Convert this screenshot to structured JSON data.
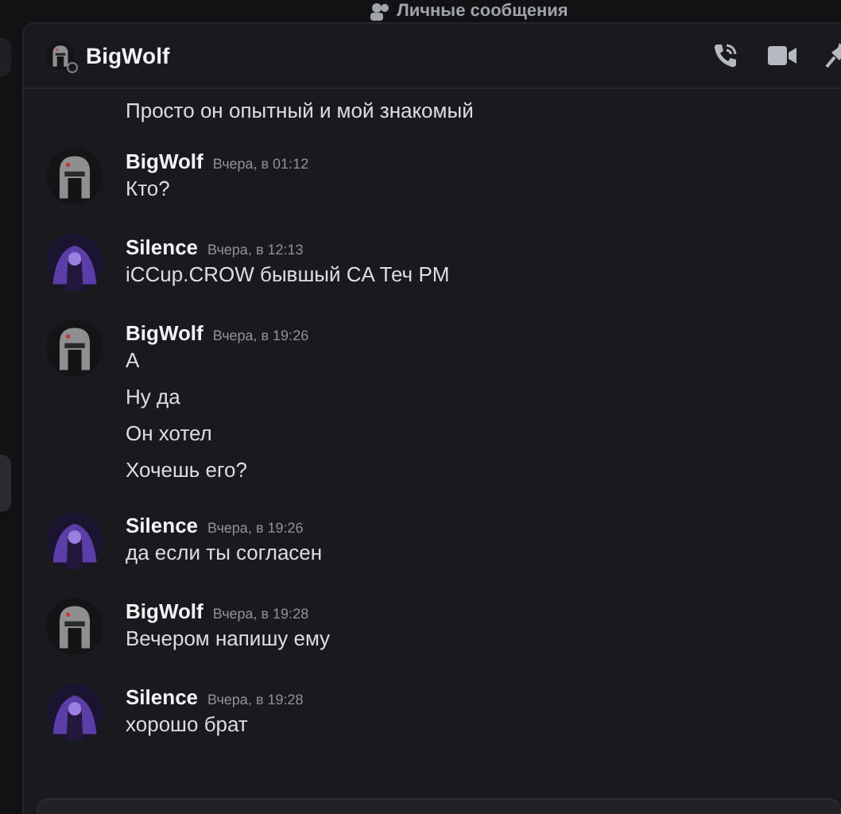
{
  "top_bar": {
    "title": "Личные сообщения"
  },
  "header": {
    "name": "BigWolf",
    "kind": "wolf"
  },
  "continued_line": "Просто он опытный и мой знакомый",
  "messages": [
    {
      "author": "BigWolf",
      "kind": "wolf",
      "time": "Вчера, в 01:12",
      "lines": [
        "Кто?"
      ]
    },
    {
      "author": "Silence",
      "kind": "silence",
      "time": "Вчера, в 12:13",
      "lines": [
        "iCCup.CROW бывшый CA Теч PM"
      ]
    },
    {
      "author": "BigWolf",
      "kind": "wolf",
      "time": "Вчера, в 19:26",
      "lines": [
        "А",
        "Ну да",
        "Он хотел",
        "Хочешь его?"
      ]
    },
    {
      "author": "Silence",
      "kind": "silence",
      "time": "Вчера, в 19:26",
      "lines": [
        "да если ты согласен"
      ]
    },
    {
      "author": "BigWolf",
      "kind": "wolf",
      "time": "Вчера, в 19:28",
      "lines": [
        "Вечером напишу ему"
      ]
    },
    {
      "author": "Silence",
      "kind": "silence",
      "time": "Вчера, в 19:28",
      "lines": [
        "хорошо брат"
      ]
    }
  ]
}
